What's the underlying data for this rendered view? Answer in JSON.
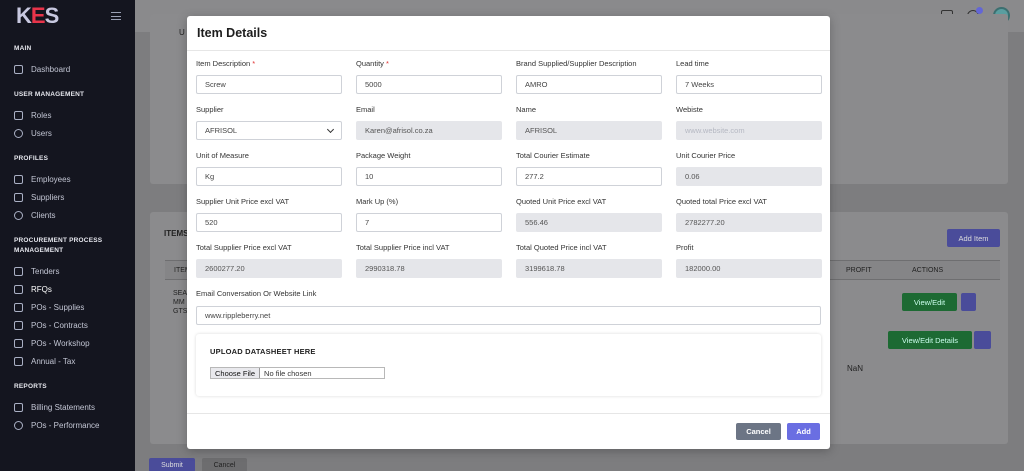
{
  "brand": {
    "logo_k": "K",
    "logo_e": "E",
    "logo_s": "S"
  },
  "sidebar": {
    "sections": [
      {
        "heading": "MAIN",
        "items": [
          {
            "label": "Dashboard",
            "icon": "monitor-icon"
          }
        ]
      },
      {
        "heading": "USER MANAGEMENT",
        "items": [
          {
            "label": "Roles",
            "icon": "roles-icon"
          },
          {
            "label": "Users",
            "icon": "users-icon"
          }
        ]
      },
      {
        "heading": "PROFILES",
        "items": [
          {
            "label": "Employees",
            "icon": "employees-icon"
          },
          {
            "label": "Suppliers",
            "icon": "truck-icon"
          },
          {
            "label": "Clients",
            "icon": "clients-icon"
          }
        ]
      },
      {
        "heading": "PROCUREMENT PROCESS MANAGEMENT",
        "items": [
          {
            "label": "Tenders",
            "icon": "tenders-icon"
          },
          {
            "label": "RFQs",
            "icon": "edit-icon"
          },
          {
            "label": "POs - Supplies",
            "icon": "clipboard-icon"
          },
          {
            "label": "POs - Contracts",
            "icon": "clipboard-icon"
          },
          {
            "label": "POs - Workshop",
            "icon": "clipboard-icon"
          },
          {
            "label": "Annual - Tax",
            "icon": "percent-icon"
          }
        ]
      },
      {
        "heading": "REPORTS",
        "items": [
          {
            "label": "Billing Statements",
            "icon": "document-icon"
          },
          {
            "label": "POs - Performance",
            "icon": "gear-icon"
          }
        ]
      }
    ]
  },
  "background": {
    "items_heading": "ITEMS",
    "add_item": "Add Item",
    "profit_col": "PROFIT",
    "actions_col": "ACTIONS",
    "item_col": "ITEM",
    "row1_text": "SEA MM GTS",
    "view_edit": "View/Edit",
    "view_edit_details": "View/Edit Details",
    "nan": "NaN",
    "submit": "Submit",
    "cancel": "Cancel",
    "card1_text": "U"
  },
  "modal": {
    "title": "Item Details",
    "fields": [
      {
        "label": "Item Description",
        "required": true,
        "value": "Screw",
        "readonly": false
      },
      {
        "label": "Quantity",
        "required": true,
        "value": "5000",
        "readonly": false
      },
      {
        "label": "Brand Supplied/Supplier Description",
        "required": false,
        "value": "AMRO",
        "readonly": false
      },
      {
        "label": "Lead time",
        "required": false,
        "value": "7 Weeks",
        "readonly": false
      },
      {
        "label": "Supplier",
        "required": false,
        "value": "AFRISOL",
        "readonly": false,
        "select": true
      },
      {
        "label": "Email",
        "required": false,
        "value": "Karen@afrisol.co.za",
        "readonly": true
      },
      {
        "label": "Name",
        "required": false,
        "value": "AFRISOL",
        "readonly": true
      },
      {
        "label": "Webiste",
        "required": false,
        "value": "",
        "placeholder": "www.website.com",
        "readonly": true
      },
      {
        "label": "Unit of Measure",
        "required": false,
        "value": "Kg",
        "readonly": false
      },
      {
        "label": "Package Weight",
        "required": false,
        "value": "10",
        "readonly": false
      },
      {
        "label": "Total Courier Estimate",
        "required": false,
        "value": "277.2",
        "readonly": false
      },
      {
        "label": "Unit Courier Price",
        "required": false,
        "value": "0.06",
        "readonly": true
      },
      {
        "label": "Supplier Unit Price excl VAT",
        "required": false,
        "value": "520",
        "readonly": false
      },
      {
        "label": "Mark Up (%)",
        "required": false,
        "value": "7",
        "readonly": false
      },
      {
        "label": "Quoted Unit Price excl VAT",
        "required": false,
        "value": "556.46",
        "readonly": true
      },
      {
        "label": "Quoted total Price excl VAT",
        "required": false,
        "value": "2782277.20",
        "readonly": true
      },
      {
        "label": "Total Supplier Price excl VAT",
        "required": false,
        "value": "2600277.20",
        "readonly": true
      },
      {
        "label": "Total Supplier Price incl VAT",
        "required": false,
        "value": "2990318.78",
        "readonly": true
      },
      {
        "label": "Total Quoted Price incl VAT",
        "required": false,
        "value": "3199618.78",
        "readonly": true
      },
      {
        "label": "Profit",
        "required": false,
        "value": "182000.00",
        "readonly": true
      }
    ],
    "link_label": "Email Conversation Or Website Link",
    "link_value": "www.rippleberry.net",
    "upload_title": "UPLOAD DATASHEET HERE",
    "choose_file": "Choose File",
    "no_file": "No file chosen",
    "cancel_label": "Cancel",
    "add_label": "Add"
  },
  "colors": {
    "accent": "#6a6ee2",
    "sidebar_bg": "#14151f",
    "success": "#1d6a33",
    "secondary": "#6c7585"
  }
}
